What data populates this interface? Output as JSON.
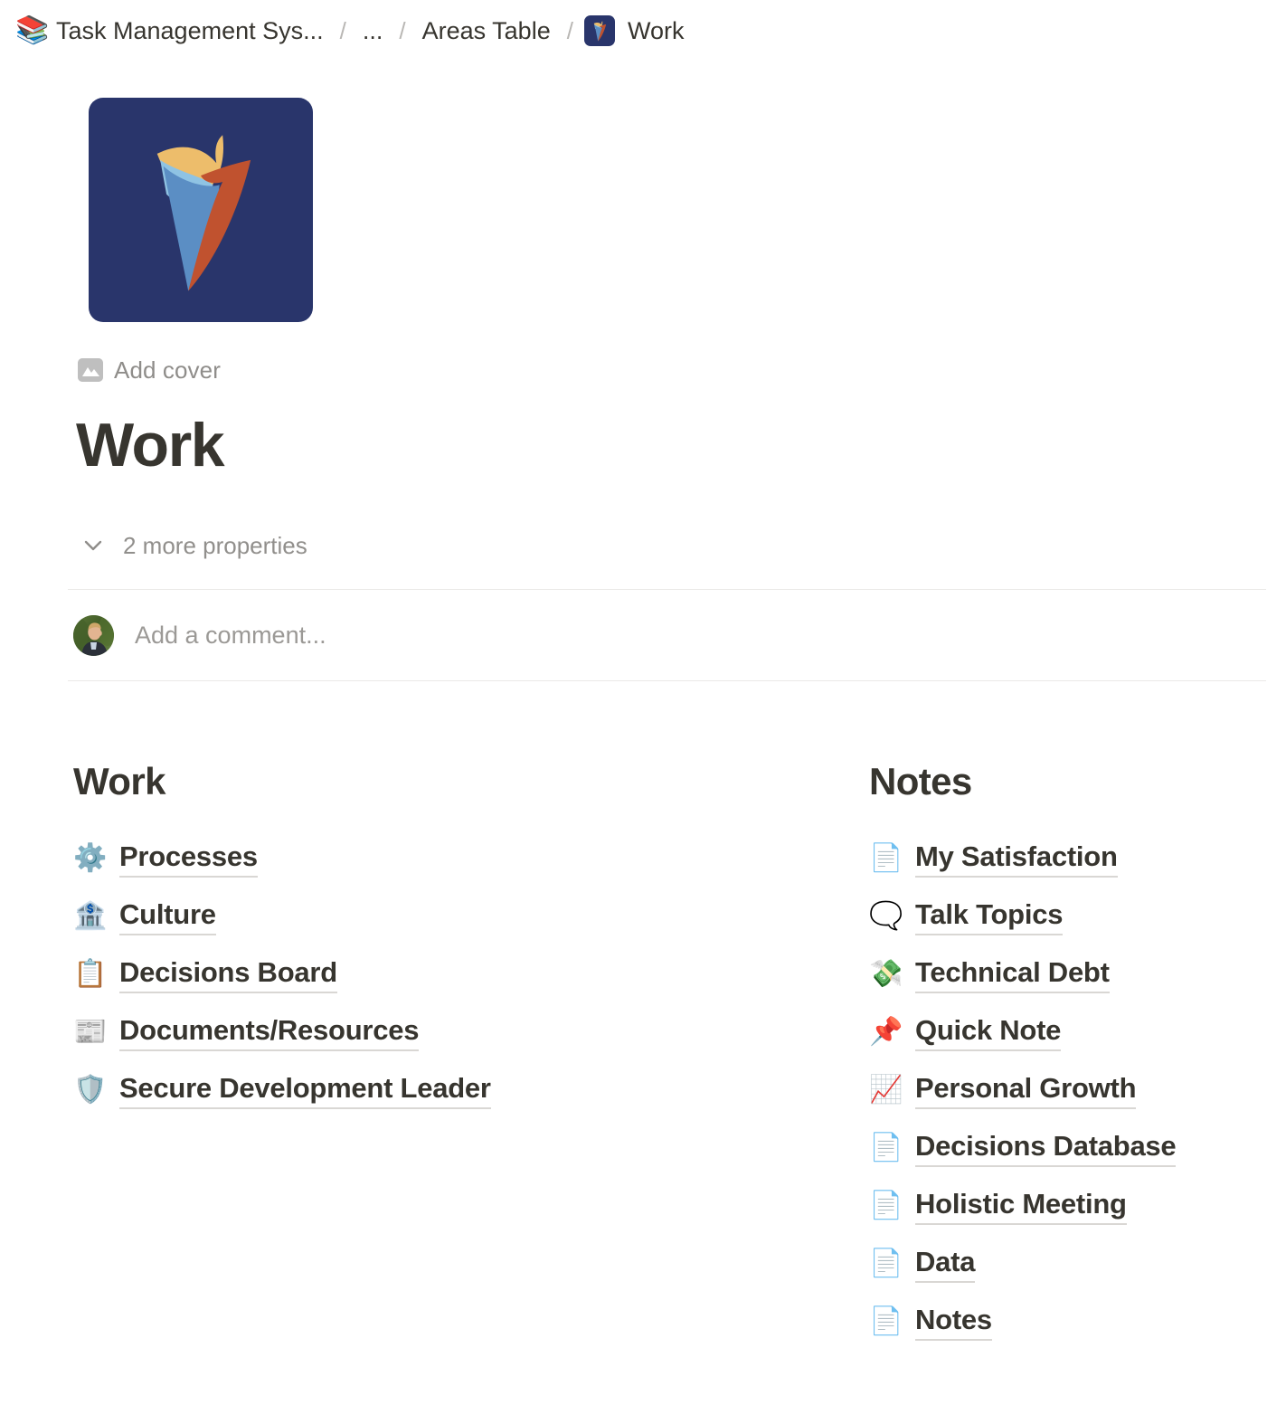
{
  "breadcrumb": {
    "workspace_emoji": "books-emoji",
    "items": [
      {
        "label": "Task Management Sys...",
        "icon": "books-emoji"
      },
      {
        "label": "...",
        "icon": ""
      },
      {
        "label": "Areas Table",
        "icon": ""
      },
      {
        "label": "Work",
        "icon": "work-logo-icon"
      }
    ],
    "separator": "/"
  },
  "page": {
    "icon_name": "work-logo-icon",
    "icon_background": "#29356b",
    "add_cover_label": "Add cover",
    "add_cover_icon": "image-icon",
    "title": "Work",
    "properties_toggle_label": "2 more properties",
    "properties_toggle_icon": "chevron-down-icon",
    "comment_placeholder": "Add a comment...",
    "avatar_name": "user-avatar"
  },
  "columns": [
    {
      "heading": "Work",
      "links": [
        {
          "emoji": "⚙️",
          "icon_name": "gear-emoji",
          "label": "Processes"
        },
        {
          "emoji": "🏦",
          "icon_name": "bank-emoji",
          "label": "Culture"
        },
        {
          "emoji": "📋",
          "icon_name": "clipboard-emoji",
          "label": "Decisions Board"
        },
        {
          "emoji": "📰",
          "icon_name": "newspaper-emoji",
          "label": "Documents/Resources"
        },
        {
          "emoji": "🛡️",
          "icon_name": "shield-emoji",
          "label": "Secure Development Leader"
        }
      ]
    },
    {
      "heading": "Notes",
      "links": [
        {
          "emoji": "📄",
          "icon_name": "page-emoji",
          "label": "My Satisfaction"
        },
        {
          "emoji": "🗨️",
          "icon_name": "speech-balloon-emoji",
          "label": "Talk Topics"
        },
        {
          "emoji": "💸",
          "icon_name": "person-money-emoji",
          "label": "Technical Debt"
        },
        {
          "emoji": "📌",
          "icon_name": "pushpin-emoji",
          "label": "Quick Note"
        },
        {
          "emoji": "📈",
          "icon_name": "growth-chart-emoji",
          "label": "Personal Growth"
        },
        {
          "emoji": "📄",
          "icon_name": "page-emoji",
          "label": "Decisions Database"
        },
        {
          "emoji": "📄",
          "icon_name": "page-emoji",
          "label": "Holistic Meeting"
        },
        {
          "emoji": "📄",
          "icon_name": "page-emoji",
          "label": "Data"
        },
        {
          "emoji": "📄",
          "icon_name": "page-emoji",
          "label": "Notes"
        }
      ]
    }
  ],
  "colors": {
    "text": "#37352F",
    "muted": "#918f8c",
    "divider": "#eae9e7",
    "underline": "#d9d7d4",
    "brand_navy": "#29356b",
    "brand_orange": "#c0522f",
    "brand_yellow": "#edbd6b",
    "brand_blue": "#5b8ec4",
    "brand_lightblue": "#8fc3e3"
  }
}
